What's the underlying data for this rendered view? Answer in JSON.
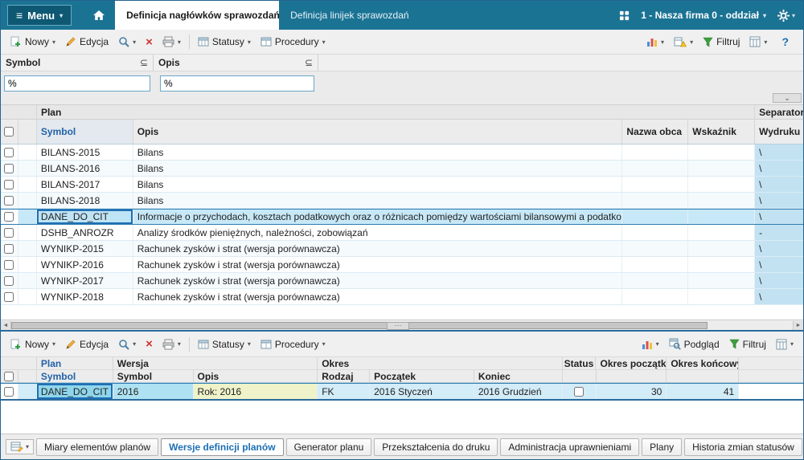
{
  "colors": {
    "topbar_bg": "#1b7394",
    "accent_blue": "#1f6fb5",
    "selection_bg": "#c7e8f7",
    "separator_column_bg": "#c2e2f2",
    "version_opis_cell_bg": "#eef3c9"
  },
  "icons": {
    "menu": "≡",
    "chevron_down": "▾",
    "subset": "⊆",
    "delete": "×",
    "help": "?",
    "collapse": "⌄",
    "scroll_left": "◄",
    "scroll_right": "►",
    "grip": "···"
  },
  "topbar": {
    "menu_label": "Menu",
    "tabs": [
      {
        "label": "Definicja nagłówków sprawozdań"
      },
      {
        "label": "Definicja linijek sprawozdań"
      }
    ],
    "company": "1 - Nasza firma 0 - oddział"
  },
  "toolbar": {
    "nowy": "Nowy",
    "edycja": "Edycja",
    "statusy": "Statusy",
    "procedury": "Procedury",
    "filtruj": "Filtruj",
    "podglad": "Podgląd"
  },
  "filters": {
    "symbol_label": "Symbol",
    "opis_label": "Opis",
    "symbol_value": "%",
    "opis_value": "%"
  },
  "table_plans": {
    "group_plan": "Plan",
    "group_separator": "Separator",
    "col_symbol": "Symbol",
    "col_opis": "Opis",
    "col_nazwa_obca": "Nazwa obca",
    "col_wskaznik": "Wskaźnik",
    "col_wydruku": "Wydruku",
    "rows": [
      {
        "symbol": "BILANS-2015",
        "opis": "Bilans",
        "separator": "\\"
      },
      {
        "symbol": "BILANS-2016",
        "opis": "Bilans",
        "separator": "\\"
      },
      {
        "symbol": "BILANS-2017",
        "opis": "Bilans",
        "separator": "\\"
      },
      {
        "symbol": "BILANS-2018",
        "opis": "Bilans",
        "separator": "\\"
      },
      {
        "symbol": "DANE_DO_CIT",
        "opis": "Informacje o przychodach, kosztach podatkowych oraz o różnicach pomiędzy wartościami bilansowymi a podatkowymi",
        "separator": "\\"
      },
      {
        "symbol": "DSHB_ANROZR",
        "opis": "Analizy środków pieniężnych, należności, zobowiązań",
        "separator": "-"
      },
      {
        "symbol": "WYNIKP-2015",
        "opis": "Rachunek zysków i strat (wersja porównawcza)",
        "separator": "\\"
      },
      {
        "symbol": "WYNIKP-2016",
        "opis": "Rachunek zysków i strat (wersja porównawcza)",
        "separator": "\\"
      },
      {
        "symbol": "WYNIKP-2017",
        "opis": "Rachunek zysków i strat (wersja porównawcza)",
        "separator": "\\"
      },
      {
        "symbol": "WYNIKP-2018",
        "opis": "Rachunek zysków i strat (wersja porównawcza)",
        "separator": "\\"
      }
    ]
  },
  "table_versions": {
    "group_plan": "Plan",
    "group_wersja": "Wersja",
    "group_okres": "Okres",
    "group_status": "Status",
    "group_okres_poczatkowy": "Okres początkowy",
    "group_okres_koncowy": "Okres końcowy",
    "col_symbol": "Symbol",
    "col_symbol2": "Symbol",
    "col_opis": "Opis",
    "col_rodzaj": "Rodzaj",
    "col_poczatek": "Początek",
    "col_koniec": "Koniec",
    "row": {
      "plan_symbol": "DANE_DO_CIT",
      "wersja_symbol": "2016",
      "opis": "Rok: 2016",
      "rodzaj": "FK",
      "poczatek": "2016 Styczeń",
      "koniec": "2016 Grudzień",
      "okres_poczatkowy": "30",
      "okres_koncowy": "41"
    }
  },
  "bottom_tabs": [
    "Miary elementów planów",
    "Wersje definicji planów",
    "Generator planu",
    "Przekształcenia do druku",
    "Administracja uprawnieniami",
    "Plany",
    "Historia zmian statusów"
  ]
}
